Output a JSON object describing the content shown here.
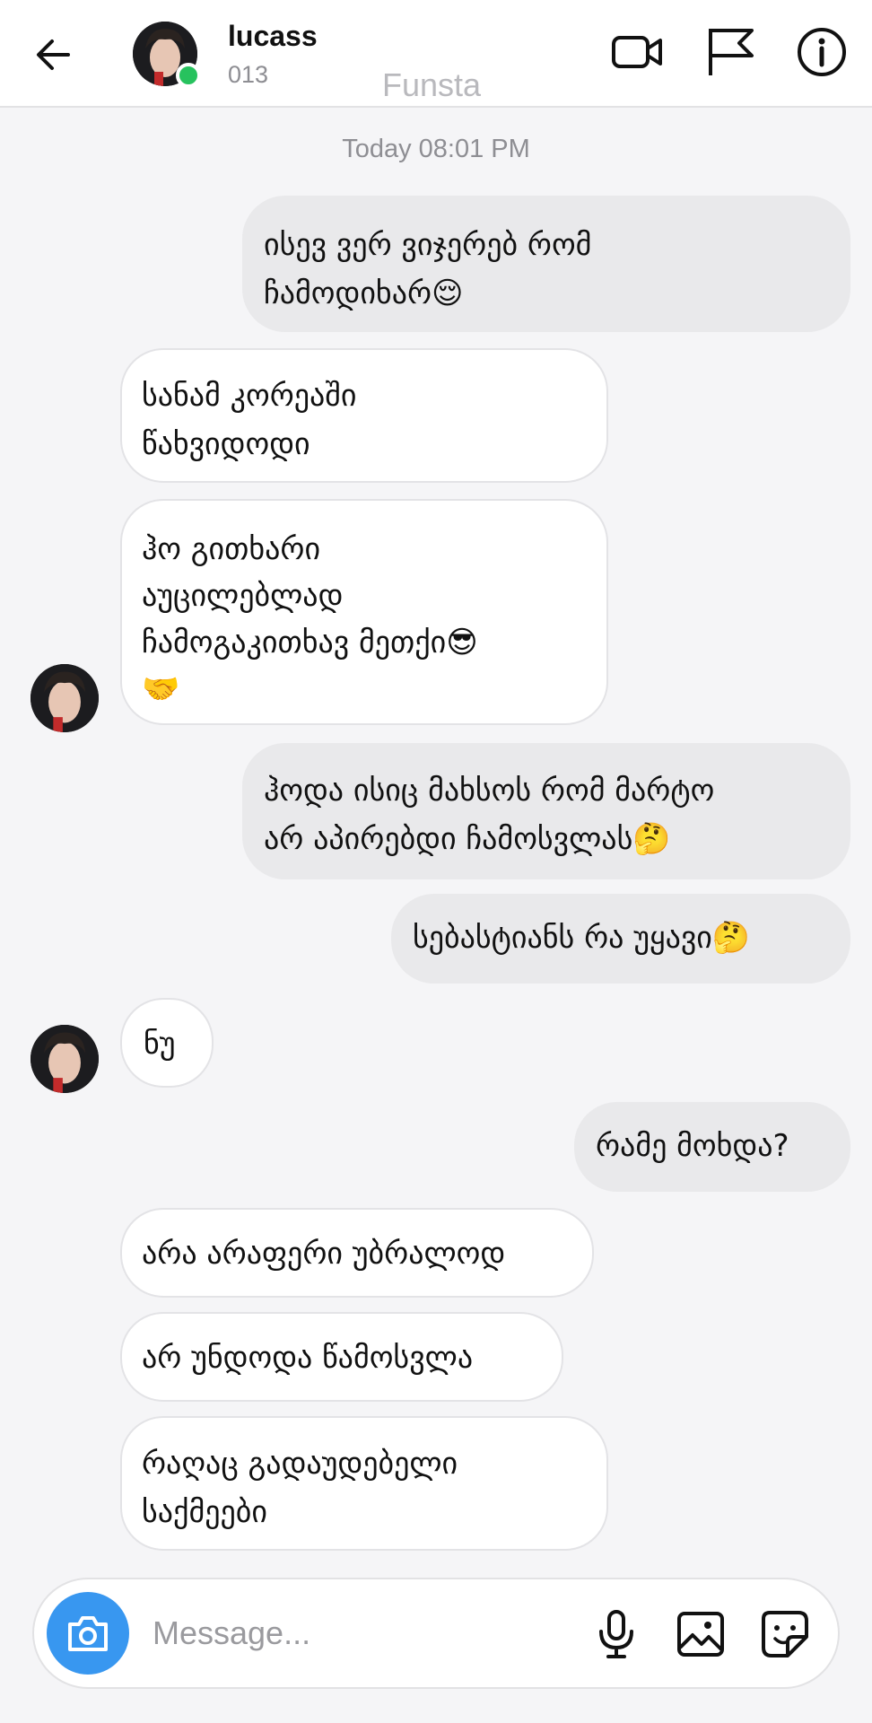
{
  "header": {
    "name": "lucass",
    "subtitle": "013",
    "watermark": "Funsta"
  },
  "timestamp": "Today 08:01 PM",
  "messages": [
    {
      "side": "out",
      "text": "ისევ ვერ ვიჯერებ რომ\nჩამოდიხარ😌"
    },
    {
      "side": "in",
      "text": "სანამ კორეაში\nწახვიდოდი"
    },
    {
      "side": "in",
      "text": "ჰო გითხარი\nაუცილებლად\nჩამოგაკითხავ მეთქი😎\n🤝"
    },
    {
      "side": "out",
      "text": "ჰოდა ისიც მახსოს რომ მარტო\nარ აპირებდი ჩამოსვლას🤔"
    },
    {
      "side": "out",
      "text": "სებასტიანს რა უყავი🤔"
    },
    {
      "side": "in",
      "text": "ნუ"
    },
    {
      "side": "out",
      "text": "რამე მოხდა?"
    },
    {
      "side": "in",
      "text": "არა არაფერი უბრალოდ"
    },
    {
      "side": "in",
      "text": "არ უნდოდა წამოსვლა"
    },
    {
      "side": "in",
      "text": "რაღაც გადაუდებელი\nსაქმეები"
    }
  ],
  "composer": {
    "placeholder": "Message..."
  },
  "icons": {
    "back": "arrow-left-icon",
    "video": "video-camera-icon",
    "flag": "flag-icon",
    "info": "info-icon",
    "camera": "camera-icon",
    "mic": "microphone-icon",
    "gallery": "image-icon",
    "sticker": "sticker-icon"
  },
  "colors": {
    "online": "#27c25e",
    "camera_button": "#3897f0",
    "outgoing_bubble": "#e9e9eb",
    "incoming_bubble": "#ffffff"
  }
}
